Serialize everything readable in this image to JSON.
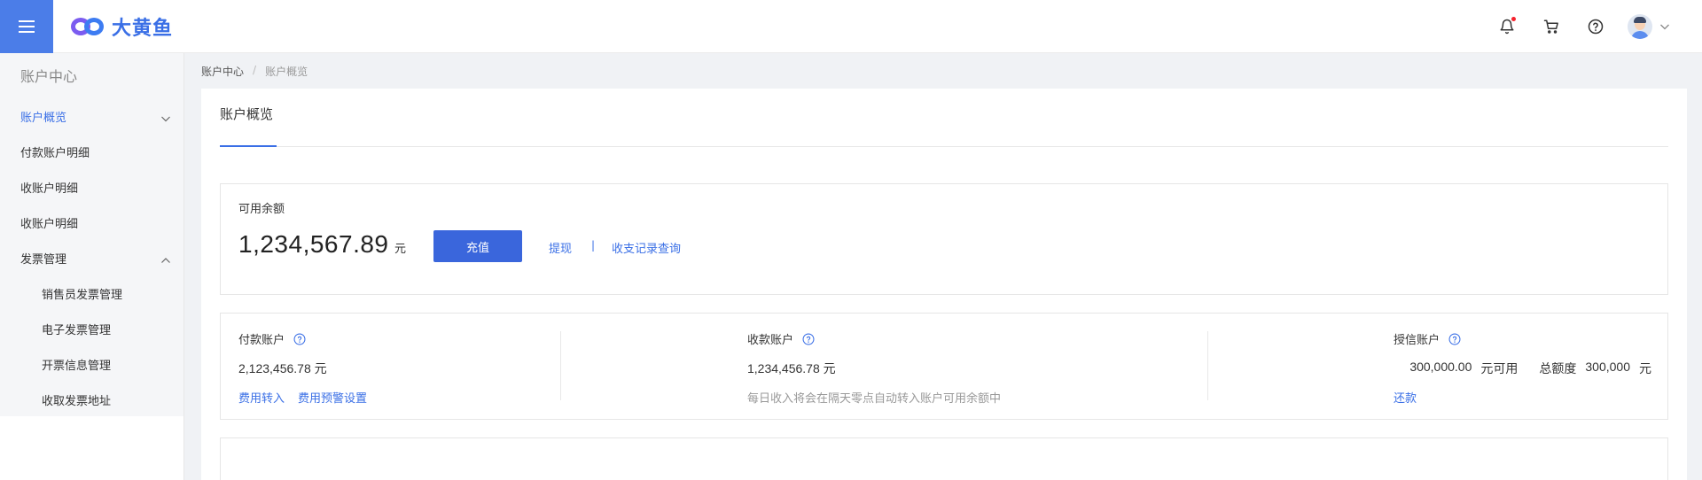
{
  "header": {
    "logo_text": "大黄鱼",
    "icons": [
      "menu-icon",
      "bell-icon",
      "cart-icon",
      "help-icon",
      "avatar",
      "chevron-down-icon"
    ],
    "accent_color": "#4b7de8"
  },
  "sidebar": {
    "title": "账户中心",
    "items": [
      {
        "label": "账户概览",
        "active": true
      },
      {
        "label": "付款账户明细"
      },
      {
        "label": "收账户明细"
      },
      {
        "label": "收账户明细"
      },
      {
        "label": "发票管理"
      },
      {
        "label": "销售员发票管理"
      },
      {
        "label": "电子发票管理"
      },
      {
        "label": "开票信息管理"
      },
      {
        "label": "收取发票地址"
      }
    ]
  },
  "breadcrumb": {
    "root": "账户中心",
    "separator": "/",
    "current": "账户概览"
  },
  "main": {
    "title": "账户概览",
    "balance": {
      "label": "可用余额",
      "amount": "1,234,567.89",
      "unit": "元",
      "recharge_label": "充值",
      "withdraw_label": "提现",
      "link_separator": "|",
      "records_label": "收支记录查询"
    },
    "accounts": {
      "payment": {
        "title": "付款账户",
        "value": "2,123,456.78 元",
        "link1": "费用转入",
        "link2": "费用预警设置"
      },
      "receipt": {
        "title": "收款账户",
        "value": "1,234,456.78 元",
        "note": "每日收入将会在隔天零点自动转入账户可用余额中"
      },
      "credit": {
        "title": "授信账户",
        "available": "300,000.00",
        "available_suffix": "元可用",
        "total_label": "总额度",
        "total": "300,000",
        "total_unit": "元",
        "repay_label": "还款"
      }
    }
  }
}
